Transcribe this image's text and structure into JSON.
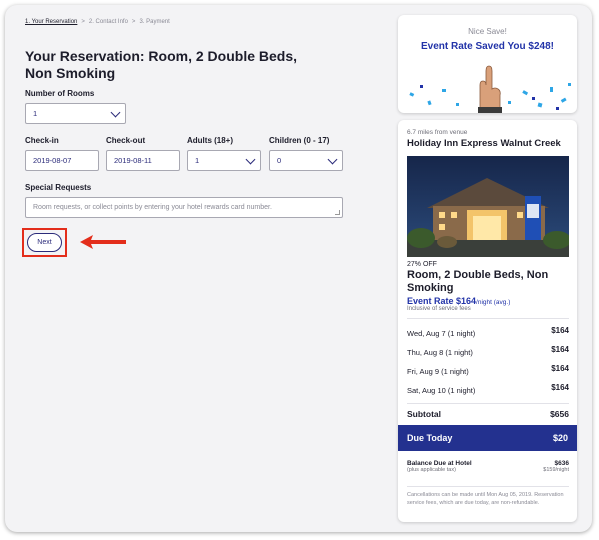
{
  "breadcrumb": {
    "steps": [
      "1. Your Reservation",
      "2. Contact Info",
      "3. Payment"
    ],
    "separator": ">"
  },
  "page_title": "Your Reservation: Room, 2 Double Beds, Non Smoking",
  "form": {
    "rooms_label": "Number of Rooms",
    "rooms_value": "1",
    "checkin_label": "Check-in",
    "checkin_value": "2019-08-07",
    "checkout_label": "Check-out",
    "checkout_value": "2019-08-11",
    "adults_label": "Adults (18+)",
    "adults_value": "1",
    "children_label": "Children (0 - 17)",
    "children_value": "0",
    "special_label": "Special Requests",
    "special_placeholder": "Room requests, or collect points by entering your hotel rewards card number.",
    "next_label": "Next"
  },
  "savings": {
    "top": "Nice Save!",
    "main": "Event Rate Saved You $248!"
  },
  "hotel": {
    "distance": "6.7 miles from venue",
    "name": "Holiday Inn Express Walnut Creek",
    "discount": "27% OFF",
    "room": "Room, 2 Double Beds, Non Smoking",
    "rate_label": "Event Rate $164",
    "rate_suffix": "/night (avg.)",
    "fees_note": "Inclusive of service fees",
    "nights": [
      {
        "label": "Wed, Aug 7 (1 night)",
        "amount": "$164"
      },
      {
        "label": "Thu, Aug 8 (1 night)",
        "amount": "$164"
      },
      {
        "label": "Fri, Aug 9 (1 night)",
        "amount": "$164"
      },
      {
        "label": "Sat, Aug 10 (1 night)",
        "amount": "$164"
      }
    ],
    "subtotal_label": "Subtotal",
    "subtotal_amount": "$656",
    "due_label": "Due Today",
    "due_amount": "$20",
    "balance_label": "Balance Due at Hotel",
    "balance_note": "(plus applicable tax)",
    "balance_amount": "$636",
    "balance_per_night": "$159/night",
    "cancel_note": "Cancellations can be made until Mon Aug 05, 2019. Reservation service fees, which are due today, are non-refundable."
  },
  "colors": {
    "accent": "#2233a8",
    "due_bar": "#23318f",
    "highlight": "#e32d1b"
  }
}
